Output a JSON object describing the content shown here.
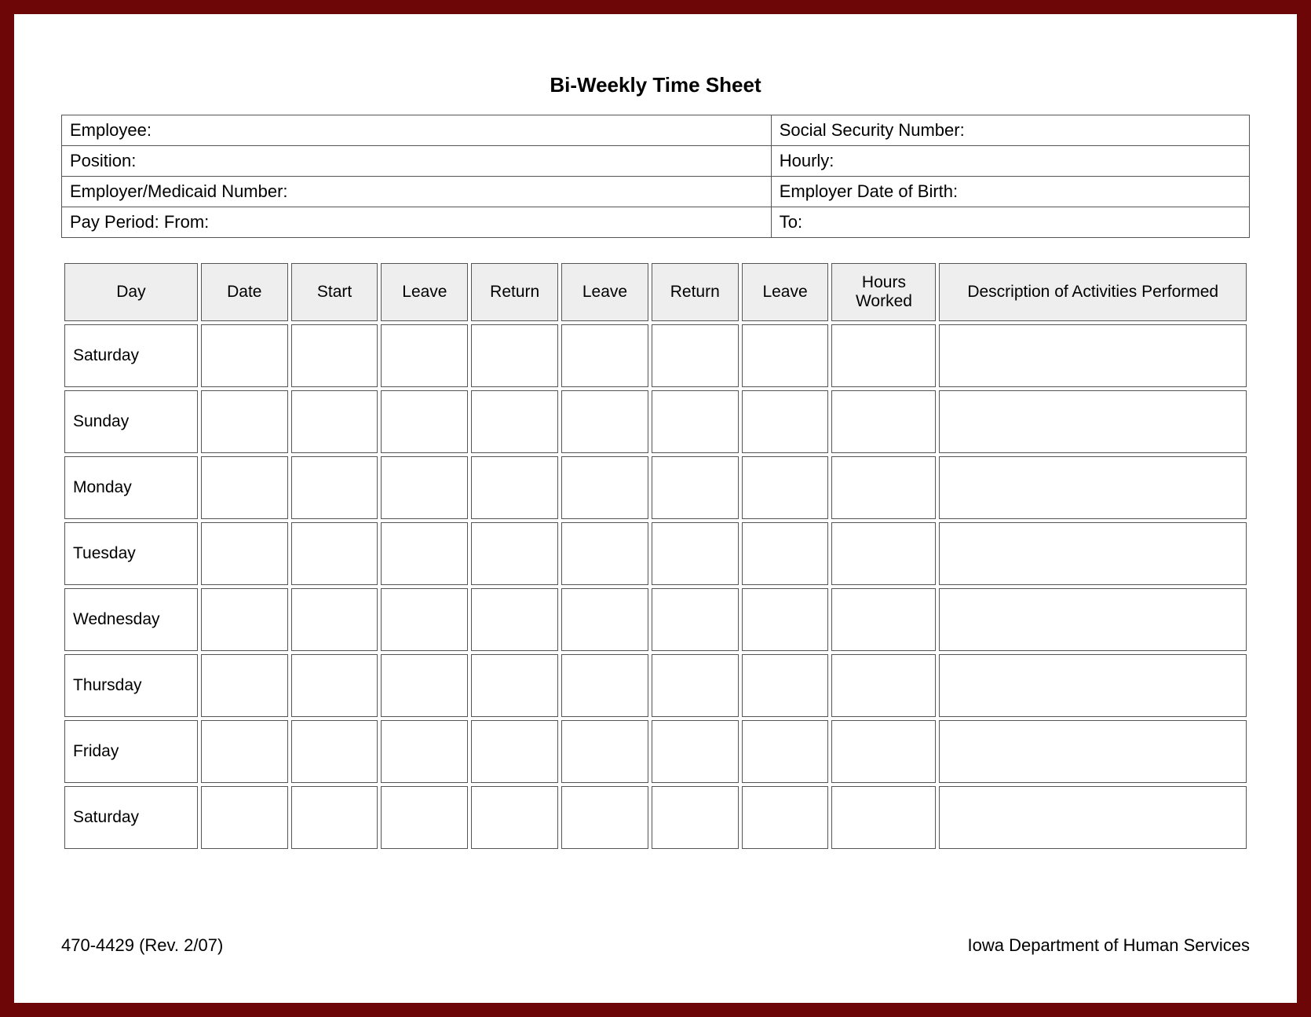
{
  "title": "Bi-Weekly Time Sheet",
  "info": {
    "employee": "Employee:",
    "ssn": "Social Security Number:",
    "position": "Position:",
    "hourly": "Hourly:",
    "medicaid": "Employer/Medicaid Number:",
    "dob": "Employer Date of Birth:",
    "pay_from": "Pay Period:  From:",
    "pay_to": "To:"
  },
  "headers": {
    "day": "Day",
    "date": "Date",
    "start": "Start",
    "leave1": "Leave",
    "return1": "Return",
    "leave2": "Leave",
    "return2": "Return",
    "leave3": "Leave",
    "hours": "Hours Worked",
    "desc": "Description of Activities Performed"
  },
  "days": [
    "Saturday",
    "Sunday",
    "Monday",
    "Tuesday",
    "Wednesday",
    "Thursday",
    "Friday",
    "Saturday"
  ],
  "footer": {
    "form_id": "470-4429  (Rev. 2/07)",
    "agency": "Iowa Department of Human Services"
  }
}
